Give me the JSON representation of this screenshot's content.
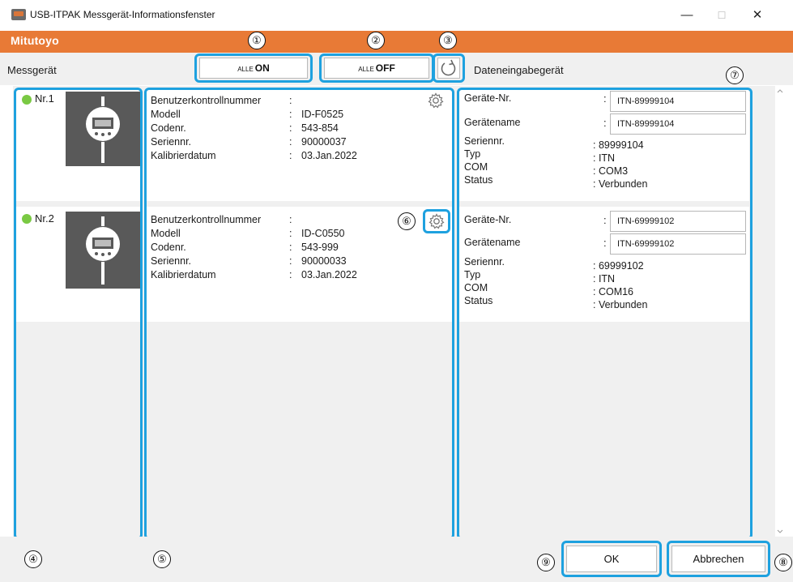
{
  "window": {
    "title": "USB-ITPAK Messgerät-Informationsfenster",
    "controls": {
      "minimize": "—",
      "maximize": "☐",
      "close": "✕"
    }
  },
  "brand": {
    "name": "Mitutoyo",
    "color": "#e87a36"
  },
  "toolbar": {
    "left_label": "Messgerät",
    "right_label": "Dateneingabegerät",
    "all_on": {
      "prefix": "ALLE",
      "label": "ON"
    },
    "all_off": {
      "prefix": "ALLE",
      "label": "OFF"
    },
    "refresh_icon": "refresh-icon"
  },
  "callouts": [
    "①",
    "②",
    "③",
    "④",
    "⑤",
    "⑥",
    "⑦",
    "⑧",
    "⑨"
  ],
  "field_labels": {
    "benutzer": "Benutzerkontrollnummer",
    "modell": "Modell",
    "codenr": "Codenr.",
    "seriennr": "Seriennr.",
    "kalibrier": "Kalibrierdatum",
    "geraete_nr": "Geräte-Nr.",
    "geraetename": "Gerätename",
    "typ": "Typ",
    "com": "COM",
    "status": "Status"
  },
  "devices": [
    {
      "number": "Nr.1",
      "status_color": "#7ac943",
      "benutzer": "",
      "modell": "ID-F0525",
      "codenr": "543-854",
      "seriennr": "90000037",
      "kalibrier": "03.Jan.2022",
      "input": {
        "geraete_nr": "ITN-89999104",
        "geraetename": "ITN-89999104",
        "seriennr": ": 89999104",
        "typ": ": ITN",
        "com": ": COM3",
        "status": ": Verbunden"
      }
    },
    {
      "number": "Nr.2",
      "status_color": "#7ac943",
      "benutzer": "",
      "modell": "ID-C0550",
      "codenr": "543-999",
      "seriennr": "90000033",
      "kalibrier": "03.Jan.2022",
      "input": {
        "geraete_nr": "ITN-69999102",
        "geraetename": "ITN-69999102",
        "seriennr": ": 69999102",
        "typ": ": ITN",
        "com": ": COM16",
        "status": ": Verbunden"
      }
    }
  ],
  "footer": {
    "ok": "OK",
    "cancel": "Abbrechen"
  },
  "accent": "#1ea1df"
}
